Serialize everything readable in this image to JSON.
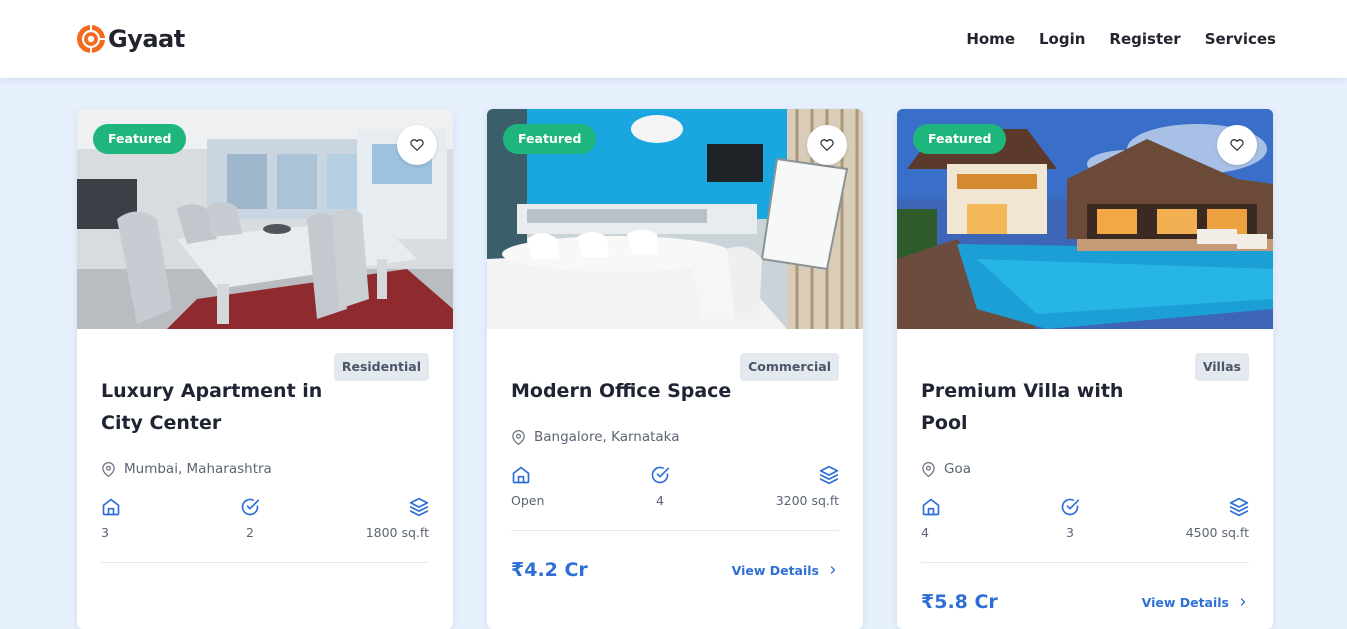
{
  "navbar": {
    "brand": "Gyaat",
    "links": [
      "Home",
      "Login",
      "Register",
      "Services"
    ]
  },
  "colors": {
    "accent": "#2e6fd6",
    "featured_badge": "#1fb67d",
    "page_bg": "#e7f0fd",
    "logo_orange": "#f26b1d"
  },
  "cards": [
    {
      "badge": "Featured",
      "category": "Residential",
      "title": "Luxury Apartment in City Center",
      "location": "Mumbai, Maharashtra",
      "stats": [
        "3",
        "2",
        "1800 sq.ft"
      ],
      "price": "",
      "link": ""
    },
    {
      "badge": "Featured",
      "category": "Commercial",
      "title": "Modern Office Space",
      "location": "Bangalore, Karnataka",
      "stats": [
        "Open",
        "4",
        "3200 sq.ft"
      ],
      "price": "₹4.2 Cr",
      "link": "View Details"
    },
    {
      "badge": "Featured",
      "category": "Villas",
      "title": "Premium Villa with Pool",
      "location": "Goa",
      "stats": [
        "4",
        "3",
        "4500 sq.ft"
      ],
      "price": "₹5.8 Cr",
      "link": "View Details"
    }
  ],
  "icons": {
    "favorite": "heart-icon",
    "location": "map-pin-icon",
    "stat_1": "home-icon",
    "stat_2": "check-circle-icon",
    "stat_3": "layers-icon",
    "link": "chevron-right-icon"
  }
}
